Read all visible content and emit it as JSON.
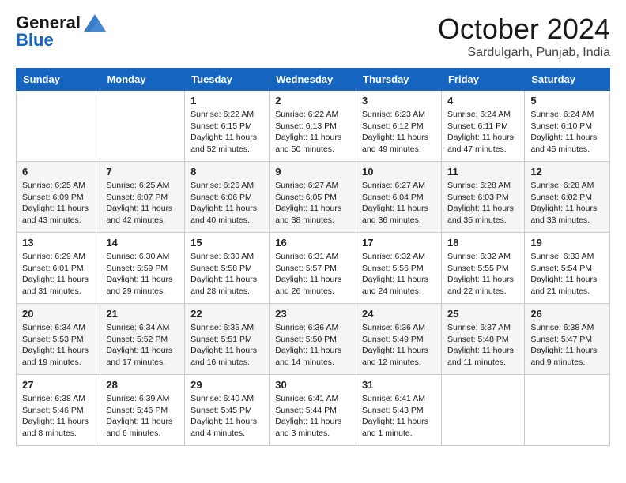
{
  "header": {
    "logo_general": "General",
    "logo_blue": "Blue",
    "month_title": "October 2024",
    "location": "Sardulgarh, Punjab, India"
  },
  "weekdays": [
    "Sunday",
    "Monday",
    "Tuesday",
    "Wednesday",
    "Thursday",
    "Friday",
    "Saturday"
  ],
  "weeks": [
    [
      {
        "day": "",
        "sunrise": "",
        "sunset": "",
        "daylight": ""
      },
      {
        "day": "",
        "sunrise": "",
        "sunset": "",
        "daylight": ""
      },
      {
        "day": "1",
        "sunrise": "Sunrise: 6:22 AM",
        "sunset": "Sunset: 6:15 PM",
        "daylight": "Daylight: 11 hours and 52 minutes."
      },
      {
        "day": "2",
        "sunrise": "Sunrise: 6:22 AM",
        "sunset": "Sunset: 6:13 PM",
        "daylight": "Daylight: 11 hours and 50 minutes."
      },
      {
        "day": "3",
        "sunrise": "Sunrise: 6:23 AM",
        "sunset": "Sunset: 6:12 PM",
        "daylight": "Daylight: 11 hours and 49 minutes."
      },
      {
        "day": "4",
        "sunrise": "Sunrise: 6:24 AM",
        "sunset": "Sunset: 6:11 PM",
        "daylight": "Daylight: 11 hours and 47 minutes."
      },
      {
        "day": "5",
        "sunrise": "Sunrise: 6:24 AM",
        "sunset": "Sunset: 6:10 PM",
        "daylight": "Daylight: 11 hours and 45 minutes."
      }
    ],
    [
      {
        "day": "6",
        "sunrise": "Sunrise: 6:25 AM",
        "sunset": "Sunset: 6:09 PM",
        "daylight": "Daylight: 11 hours and 43 minutes."
      },
      {
        "day": "7",
        "sunrise": "Sunrise: 6:25 AM",
        "sunset": "Sunset: 6:07 PM",
        "daylight": "Daylight: 11 hours and 42 minutes."
      },
      {
        "day": "8",
        "sunrise": "Sunrise: 6:26 AM",
        "sunset": "Sunset: 6:06 PM",
        "daylight": "Daylight: 11 hours and 40 minutes."
      },
      {
        "day": "9",
        "sunrise": "Sunrise: 6:27 AM",
        "sunset": "Sunset: 6:05 PM",
        "daylight": "Daylight: 11 hours and 38 minutes."
      },
      {
        "day": "10",
        "sunrise": "Sunrise: 6:27 AM",
        "sunset": "Sunset: 6:04 PM",
        "daylight": "Daylight: 11 hours and 36 minutes."
      },
      {
        "day": "11",
        "sunrise": "Sunrise: 6:28 AM",
        "sunset": "Sunset: 6:03 PM",
        "daylight": "Daylight: 11 hours and 35 minutes."
      },
      {
        "day": "12",
        "sunrise": "Sunrise: 6:28 AM",
        "sunset": "Sunset: 6:02 PM",
        "daylight": "Daylight: 11 hours and 33 minutes."
      }
    ],
    [
      {
        "day": "13",
        "sunrise": "Sunrise: 6:29 AM",
        "sunset": "Sunset: 6:01 PM",
        "daylight": "Daylight: 11 hours and 31 minutes."
      },
      {
        "day": "14",
        "sunrise": "Sunrise: 6:30 AM",
        "sunset": "Sunset: 5:59 PM",
        "daylight": "Daylight: 11 hours and 29 minutes."
      },
      {
        "day": "15",
        "sunrise": "Sunrise: 6:30 AM",
        "sunset": "Sunset: 5:58 PM",
        "daylight": "Daylight: 11 hours and 28 minutes."
      },
      {
        "day": "16",
        "sunrise": "Sunrise: 6:31 AM",
        "sunset": "Sunset: 5:57 PM",
        "daylight": "Daylight: 11 hours and 26 minutes."
      },
      {
        "day": "17",
        "sunrise": "Sunrise: 6:32 AM",
        "sunset": "Sunset: 5:56 PM",
        "daylight": "Daylight: 11 hours and 24 minutes."
      },
      {
        "day": "18",
        "sunrise": "Sunrise: 6:32 AM",
        "sunset": "Sunset: 5:55 PM",
        "daylight": "Daylight: 11 hours and 22 minutes."
      },
      {
        "day": "19",
        "sunrise": "Sunrise: 6:33 AM",
        "sunset": "Sunset: 5:54 PM",
        "daylight": "Daylight: 11 hours and 21 minutes."
      }
    ],
    [
      {
        "day": "20",
        "sunrise": "Sunrise: 6:34 AM",
        "sunset": "Sunset: 5:53 PM",
        "daylight": "Daylight: 11 hours and 19 minutes."
      },
      {
        "day": "21",
        "sunrise": "Sunrise: 6:34 AM",
        "sunset": "Sunset: 5:52 PM",
        "daylight": "Daylight: 11 hours and 17 minutes."
      },
      {
        "day": "22",
        "sunrise": "Sunrise: 6:35 AM",
        "sunset": "Sunset: 5:51 PM",
        "daylight": "Daylight: 11 hours and 16 minutes."
      },
      {
        "day": "23",
        "sunrise": "Sunrise: 6:36 AM",
        "sunset": "Sunset: 5:50 PM",
        "daylight": "Daylight: 11 hours and 14 minutes."
      },
      {
        "day": "24",
        "sunrise": "Sunrise: 6:36 AM",
        "sunset": "Sunset: 5:49 PM",
        "daylight": "Daylight: 11 hours and 12 minutes."
      },
      {
        "day": "25",
        "sunrise": "Sunrise: 6:37 AM",
        "sunset": "Sunset: 5:48 PM",
        "daylight": "Daylight: 11 hours and 11 minutes."
      },
      {
        "day": "26",
        "sunrise": "Sunrise: 6:38 AM",
        "sunset": "Sunset: 5:47 PM",
        "daylight": "Daylight: 11 hours and 9 minutes."
      }
    ],
    [
      {
        "day": "27",
        "sunrise": "Sunrise: 6:38 AM",
        "sunset": "Sunset: 5:46 PM",
        "daylight": "Daylight: 11 hours and 8 minutes."
      },
      {
        "day": "28",
        "sunrise": "Sunrise: 6:39 AM",
        "sunset": "Sunset: 5:46 PM",
        "daylight": "Daylight: 11 hours and 6 minutes."
      },
      {
        "day": "29",
        "sunrise": "Sunrise: 6:40 AM",
        "sunset": "Sunset: 5:45 PM",
        "daylight": "Daylight: 11 hours and 4 minutes."
      },
      {
        "day": "30",
        "sunrise": "Sunrise: 6:41 AM",
        "sunset": "Sunset: 5:44 PM",
        "daylight": "Daylight: 11 hours and 3 minutes."
      },
      {
        "day": "31",
        "sunrise": "Sunrise: 6:41 AM",
        "sunset": "Sunset: 5:43 PM",
        "daylight": "Daylight: 11 hours and 1 minute."
      },
      {
        "day": "",
        "sunrise": "",
        "sunset": "",
        "daylight": ""
      },
      {
        "day": "",
        "sunrise": "",
        "sunset": "",
        "daylight": ""
      }
    ]
  ]
}
